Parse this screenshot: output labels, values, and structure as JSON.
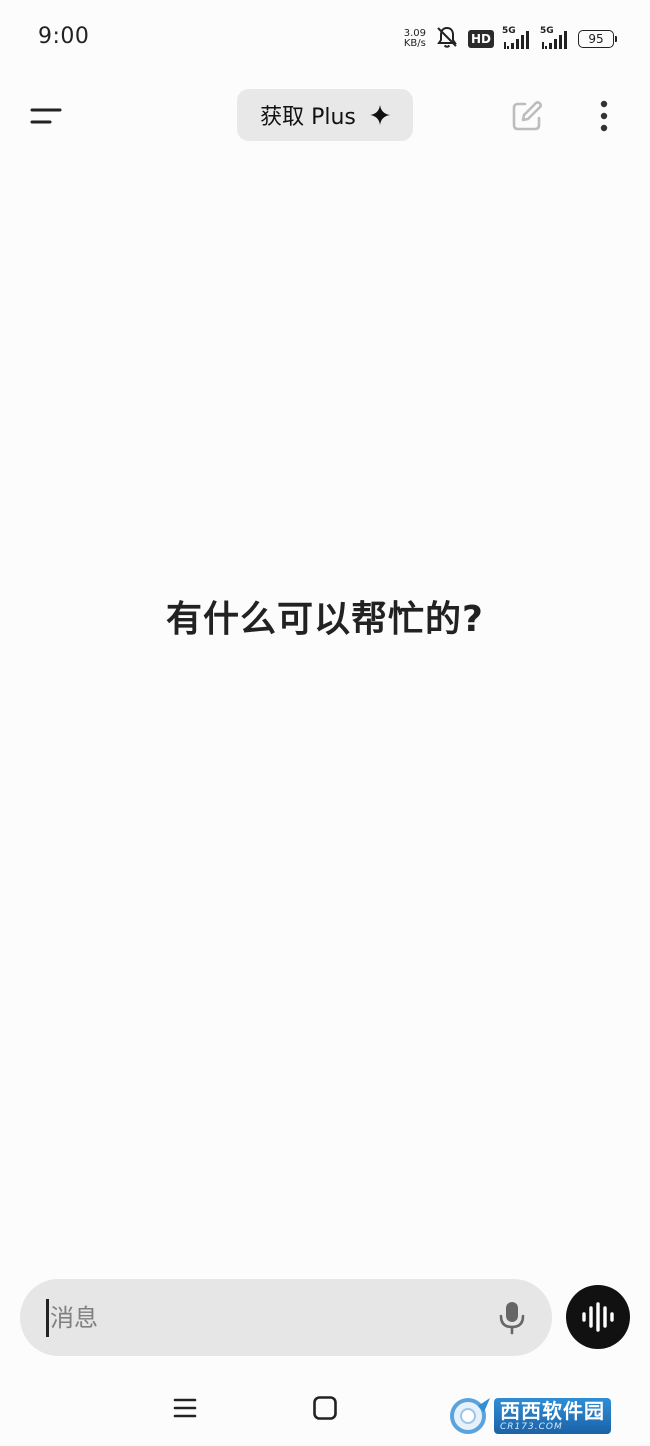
{
  "status_bar": {
    "time": "9:00",
    "net_speed_value": "3.09",
    "net_speed_unit": "KB/s",
    "hd_label": "HD",
    "signal1_label": "5G",
    "signal2_label": "5G",
    "battery": "95"
  },
  "header": {
    "plus_label": "获取 Plus",
    "menu_icon": "menu-icon",
    "edit_icon": "new-chat-icon",
    "more_icon": "more-vertical-icon"
  },
  "main": {
    "prompt": "有什么可以帮忙的?"
  },
  "composer": {
    "placeholder": "消息",
    "value": "",
    "mic_icon": "microphone-icon",
    "voice_icon": "voice-mode-icon"
  },
  "nav_bar": {
    "recents_icon": "recents-icon",
    "home_icon": "home-icon"
  },
  "watermark": {
    "title": "西西软件园",
    "subtitle": "CR173.COM"
  },
  "colors": {
    "background": "#fcfcfc",
    "pill": "#e8e8e8",
    "input": "#e6e6e6",
    "voice_button": "#111111",
    "watermark_blue": "#1b62a8"
  }
}
